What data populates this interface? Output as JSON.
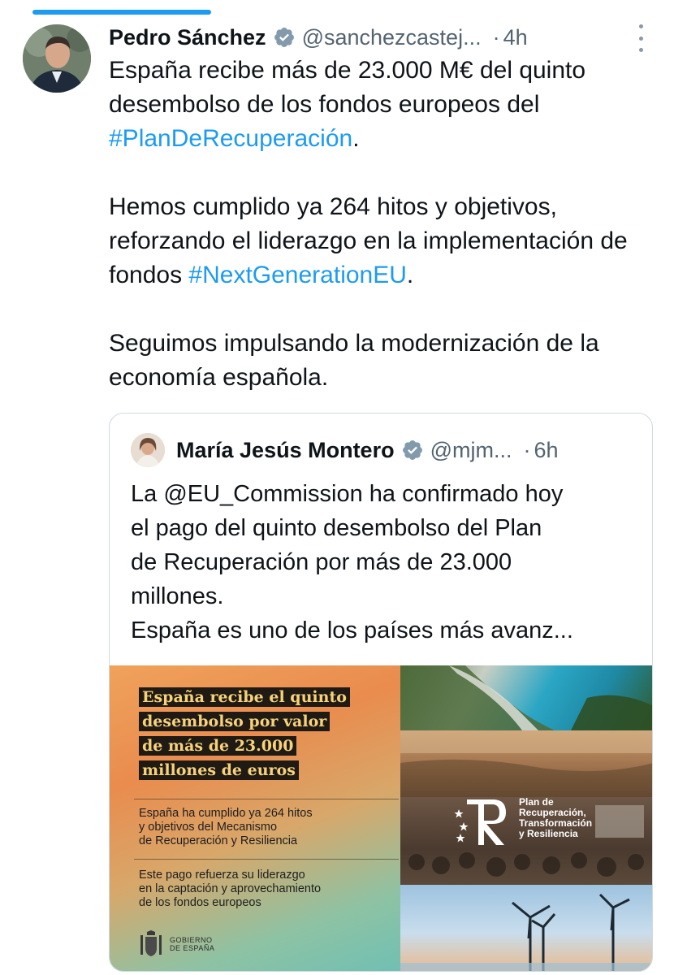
{
  "tweet": {
    "author_name": "Pedro Sánchez",
    "handle": "@sanchezcastej...",
    "separator": "·",
    "time": "4h",
    "paragraphs": [
      [
        {
          "text": "España recibe más de 23.000 M€ del quinto desembolso de los fondos europeos del ",
          "type": "text"
        },
        {
          "text": "#PlanDeRecuperación",
          "type": "hashtag"
        },
        {
          "text": ".",
          "type": "text"
        }
      ],
      [
        {
          "text": "Hemos cumplido ya 264 hitos y objetivos, reforzando el liderazgo en la implementación de fondos ",
          "type": "text"
        },
        {
          "text": "#NextGenerationEU",
          "type": "hashtag"
        },
        {
          "text": ".",
          "type": "text"
        }
      ],
      [
        {
          "text": "Seguimos impulsando la modernización de la economía española.",
          "type": "text"
        }
      ]
    ]
  },
  "quote": {
    "author_name": "María Jesús Montero",
    "handle": "@mjm...",
    "separator": "·",
    "time": "6h",
    "text_lines": [
      "La @EU_Commission ha confirmado hoy",
      "el pago del quinto desembolso del Plan",
      "de Recuperación por más de 23.000",
      "millones.",
      "España es uno de los países más avanz..."
    ]
  },
  "media": {
    "headline_lines": [
      "España recibe el quinto",
      "desembolso por valor",
      "de más de 23.000",
      "millones de euros"
    ],
    "point1_lines": [
      "España ha cumplido ya 264 hitos",
      "y objetivos del Mecanismo",
      "de Recuperación y Resiliencia"
    ],
    "point2_lines": [
      "Este pago refuerza su liderazgo",
      "en la captación y aprovechamiento",
      "de los fondos europeos"
    ],
    "gov_lines": [
      "GOBIERNO",
      "DE ESPAÑA"
    ],
    "plan_logo_lines": [
      "Plan de",
      "Recuperación,",
      "Transformación",
      "y Resiliencia"
    ]
  },
  "colors": {
    "accent": "#1d9bf0",
    "verified": "#829aab",
    "secondary_text": "#536471"
  }
}
